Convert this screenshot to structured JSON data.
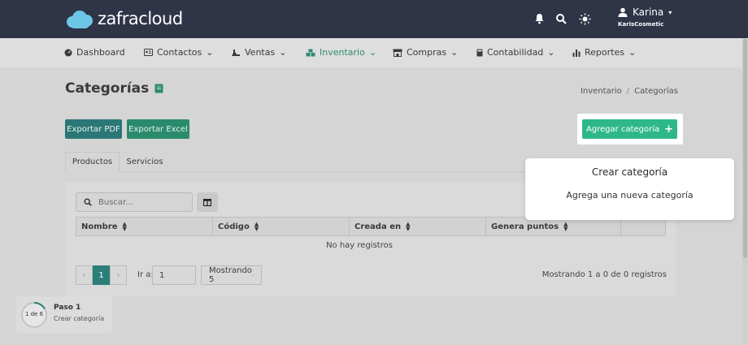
{
  "brand": {
    "name": "zafracloud",
    "accent": "#2eb88a",
    "topbar_bg": "#2f3447",
    "logo_color": "#6ec6e6"
  },
  "header": {
    "icons": [
      "bell-icon",
      "search-icon",
      "sun-icon"
    ],
    "user": {
      "name": "Karina",
      "company": "KarisCosmetic"
    }
  },
  "nav": {
    "items": [
      {
        "label": "Dashboard",
        "icon": "dashboard-icon",
        "dropdown": false,
        "active": false
      },
      {
        "label": "Contactos",
        "icon": "contacts-icon",
        "dropdown": true,
        "active": false
      },
      {
        "label": "Ventas",
        "icon": "sales-icon",
        "dropdown": true,
        "active": false
      },
      {
        "label": "Inventario",
        "icon": "inventory-icon",
        "dropdown": true,
        "active": true
      },
      {
        "label": "Compras",
        "icon": "store-icon",
        "dropdown": true,
        "active": false
      },
      {
        "label": "Contabilidad",
        "icon": "calculator-icon",
        "dropdown": true,
        "active": false
      },
      {
        "label": "Reportes",
        "icon": "bar-chart-icon",
        "dropdown": true,
        "active": false
      }
    ]
  },
  "page": {
    "title": "Categorías",
    "breadcrumb": [
      "Inventario",
      "/",
      "Categorías"
    ],
    "export_pdf": "Exportar PDF",
    "export_excel": "Exportar Excel",
    "add_button": "Agregar categoría",
    "tabs": [
      "Productos",
      "Servicios"
    ]
  },
  "table": {
    "search_placeholder": "Buscar...",
    "columns": [
      "Nombre",
      "Código",
      "Creada en",
      "Genera puntos"
    ],
    "empty_message": "No hay registros",
    "pagination": {
      "current_page": "1",
      "goto_label": "Ir a:",
      "goto_value": "1",
      "page_size_label": "Mostrando 5",
      "summary": "Mostrando 1 a 0 de 0 registros"
    }
  },
  "tour": {
    "popover_title": "Crear categoría",
    "popover_body": "Agrega una nueva categoría",
    "step_count": "1 de 6",
    "step_title": "Paso 1",
    "step_subtitle": "Crear categoría",
    "step_progress": 0.1667
  }
}
